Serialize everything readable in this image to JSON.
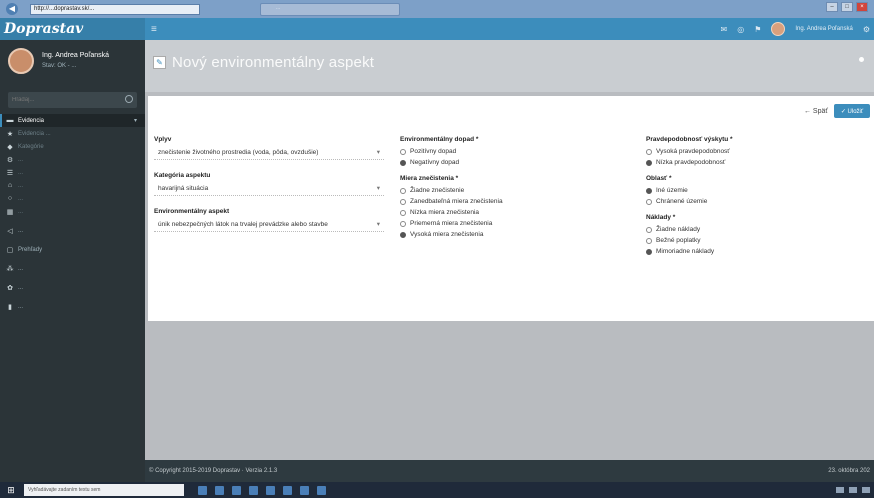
{
  "browser": {
    "address": "http://...doprastav.sk/...",
    "tab_title": "...",
    "controls": [
      "–",
      "□",
      "×"
    ]
  },
  "app": {
    "logo": "Doprastav",
    "top_user": "Ing. Andrea Poľanská"
  },
  "sidebar": {
    "user_name": "Ing. Andrea Poľanská",
    "user_sub": "Stav: OK - ...",
    "search_placeholder": "Hľadaj...",
    "items": [
      {
        "label": "Evidencia",
        "icon": "briefcase-icon",
        "active": true
      },
      {
        "label": "Evidencia ...",
        "icon": "star-icon"
      },
      {
        "label": "Kategórie",
        "icon": "tag-icon"
      },
      {
        "label": "...",
        "icon": "gear-icon"
      },
      {
        "label": "...",
        "icon": "list-icon"
      },
      {
        "label": "...",
        "icon": "home-icon"
      },
      {
        "label": "...",
        "icon": "search-icon"
      },
      {
        "label": "...",
        "icon": "table-icon"
      },
      {
        "label": "...",
        "icon": "share-icon"
      },
      {
        "label": "Prehľady",
        "icon": "chart-icon"
      },
      {
        "label": "...",
        "icon": "sitemap-icon"
      },
      {
        "label": "...",
        "icon": "settings-icon"
      },
      {
        "label": "...",
        "icon": "bar-chart-icon"
      }
    ]
  },
  "header": {
    "title": "Nový environmentálny aspekt",
    "back_label": "← Späť",
    "save_label": "✓ Uložiť"
  },
  "form": {
    "col1": {
      "vplyv_label": "Vplyv",
      "vplyv_value": "znečistenie životného prostredia (voda, pôda, ovzdušie)",
      "kategoria_label": "Kategória aspektu",
      "kategoria_value": "havarijná situácia",
      "env_label": "Environmentálny aspekt",
      "env_value": "únik nebezpečných látok na trvalej prevádzke alebo stavbe"
    },
    "col2": {
      "dopad_label": "Environmentálny dopad *",
      "dopad_options": [
        {
          "label": "Pozitívny dopad",
          "on": false
        },
        {
          "label": "Negatívny dopad",
          "on": true
        }
      ],
      "miera_label": "Miera znečistenia *",
      "miera_options": [
        {
          "label": "Žiadne znečistenie",
          "on": false
        },
        {
          "label": "Zanedbateľná miera znečistenia",
          "on": false
        },
        {
          "label": "Nízka miera znečistenia",
          "on": false
        },
        {
          "label": "Priemerná miera znečistenia",
          "on": false
        },
        {
          "label": "Vysoká miera znečistenia",
          "on": true
        }
      ]
    },
    "col3": {
      "pravd_label": "Pravdepodobnosť výskytu *",
      "pravd_options": [
        {
          "label": "Vysoká pravdepodobnosť",
          "on": false
        },
        {
          "label": "Nízka pravdepodobnosť",
          "on": true
        }
      ],
      "oblast_label": "Oblasť *",
      "oblast_options": [
        {
          "label": "Iné územie",
          "on": true
        },
        {
          "label": "Chránené územie",
          "on": false
        }
      ],
      "naklady_label": "Náklady *",
      "naklady_options": [
        {
          "label": "Žiadne náklady",
          "on": false
        },
        {
          "label": "Bežné poplatky",
          "on": false
        },
        {
          "label": "Mimoriadne náklady",
          "on": true
        }
      ]
    }
  },
  "footer": {
    "copyright": "© Copyright 2015-2019 Doprastav · Verzia 2.1.3",
    "date": "23. októbra 202"
  },
  "taskbar": {
    "search_placeholder": "Vyhľadávajte zadaním textu sem"
  }
}
